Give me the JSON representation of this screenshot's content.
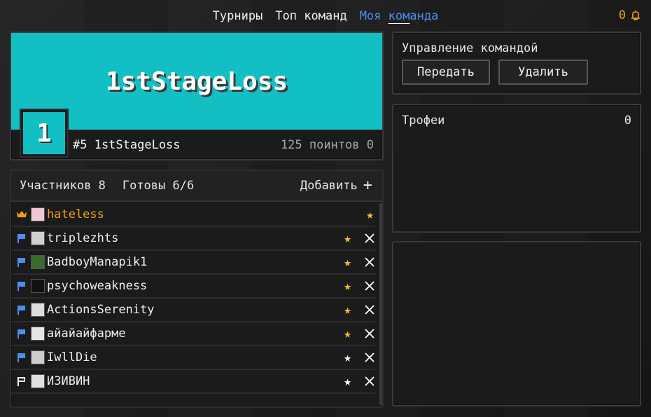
{
  "nav": {
    "tabs": [
      {
        "label": "Турниры"
      },
      {
        "label": "Топ команд"
      },
      {
        "label_a": "Моя ",
        "label_b": "ком",
        "label_c": "анда"
      }
    ],
    "notifications_count": "0"
  },
  "team": {
    "name": "1stStageLoss",
    "badge": "1",
    "rank_line": "#5 1stStageLoss",
    "points_line": "125 поинтов 0",
    "banner_color": "#12bfc3"
  },
  "members": {
    "count_label": "Участников 8",
    "ready_label": "Готовы 6/6",
    "add_label": "Добавить",
    "list": [
      {
        "name": "hateless",
        "role": "crown",
        "star": "gold"
      },
      {
        "name": "triplezhts",
        "role": "flag",
        "star": "gold"
      },
      {
        "name": "BadboyManapik1",
        "role": "flag",
        "star": "gold"
      },
      {
        "name": "psychoweakness",
        "role": "flag",
        "star": "gold"
      },
      {
        "name": "ActionsSerenity",
        "role": "flag",
        "star": "gold"
      },
      {
        "name": "айайайфарме",
        "role": "flag",
        "star": "gold"
      },
      {
        "name": "IwllDie",
        "role": "flag",
        "star": "white"
      },
      {
        "name": "ИЗИВИН",
        "role": "flag-outline",
        "star": "white"
      }
    ]
  },
  "manage": {
    "title": "Управление командой",
    "transfer_label": "Передать",
    "delete_label": "Удалить"
  },
  "trophies": {
    "title": "Трофеи",
    "count": "0"
  },
  "colors": {
    "accent_blue": "#4a8ef0",
    "gold": "#f2a20c",
    "star_gold": "#f2c12e"
  }
}
